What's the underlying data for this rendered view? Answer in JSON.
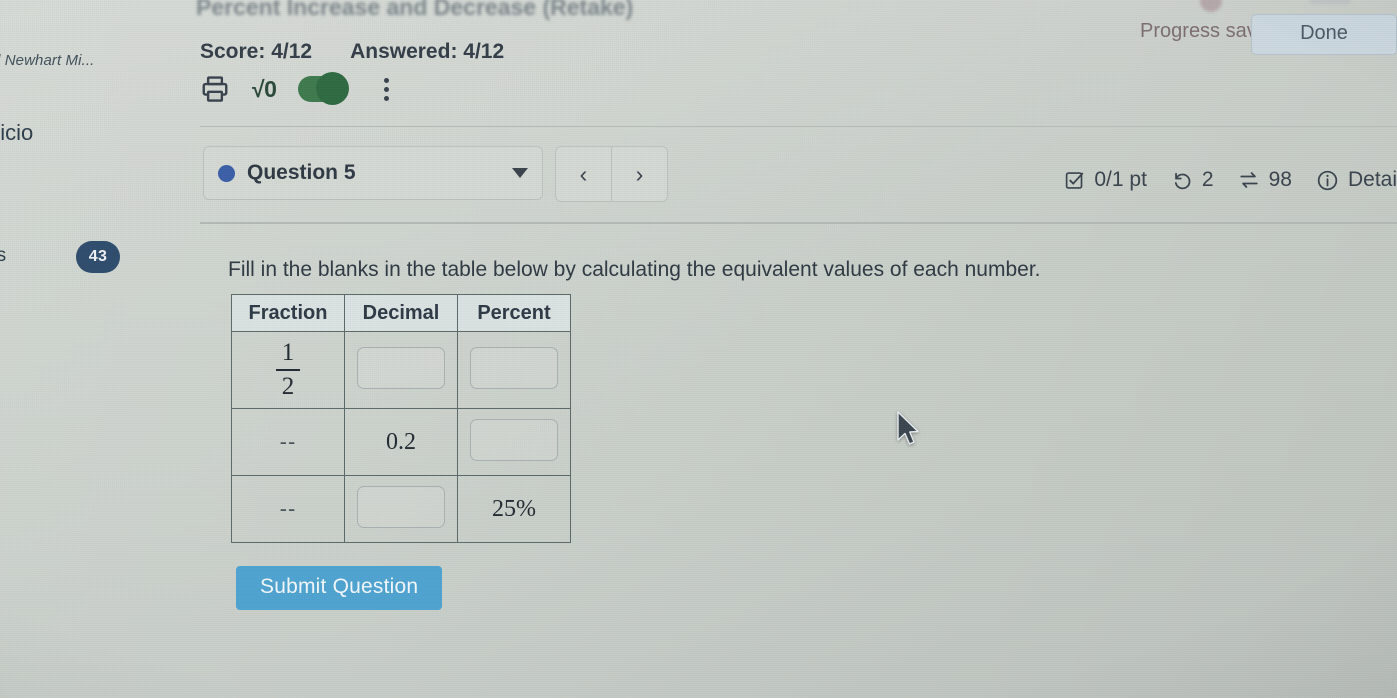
{
  "page": {
    "heading": "Percent Increase and Decrease (Retake)",
    "background_color": "#ccd2cc"
  },
  "sidebar": {
    "course_label": "d Newhart Mi...",
    "home_label": "nicio",
    "messages_label": "es",
    "messages_badge": "43",
    "badge_color": "#2f4d6e"
  },
  "header": {
    "score_label": "Score: 4/12",
    "answered_label": "Answered: 4/12",
    "progress_saved_label": "Progress saved",
    "done_label": "Done",
    "toolbar": {
      "print_icon": "printer-icon",
      "math_label": "√0",
      "toggle_state": "on",
      "toggle_color": "#3f7a4e",
      "menu_icon": "kebab-menu-icon"
    }
  },
  "question_bar": {
    "question_label": "Question 5",
    "dot_color": "#3c5fa8",
    "dropdown_icon": "chevron-down-icon",
    "prev_label": "‹",
    "next_label": "›"
  },
  "status": {
    "points_label": "0/1 pt",
    "attempts_label": "2",
    "version_label": "98",
    "details_label": "Detai",
    "checkbox_icon": "checkbox-icon",
    "retry_icon": "undo-arrow-icon",
    "swap_icon": "swap-arrows-icon",
    "info_icon": "info-circle-icon"
  },
  "question": {
    "prompt": "Fill in the blanks in the table below by calculating the equivalent values of each number.",
    "table": {
      "headers": [
        "Fraction",
        "Decimal",
        "Percent"
      ],
      "rows": [
        {
          "fraction": {
            "type": "fraction",
            "numerator": "1",
            "denominator": "2"
          },
          "decimal": {
            "type": "input",
            "value": ""
          },
          "percent": {
            "type": "input",
            "value": ""
          }
        },
        {
          "fraction": {
            "type": "text",
            "value": "--"
          },
          "decimal": {
            "type": "text",
            "value": "0.2"
          },
          "percent": {
            "type": "input",
            "value": ""
          }
        },
        {
          "fraction": {
            "type": "text",
            "value": "--"
          },
          "decimal": {
            "type": "input",
            "value": ""
          },
          "percent": {
            "type": "text",
            "value": "25%"
          }
        }
      ]
    },
    "submit_label": "Submit Question"
  }
}
